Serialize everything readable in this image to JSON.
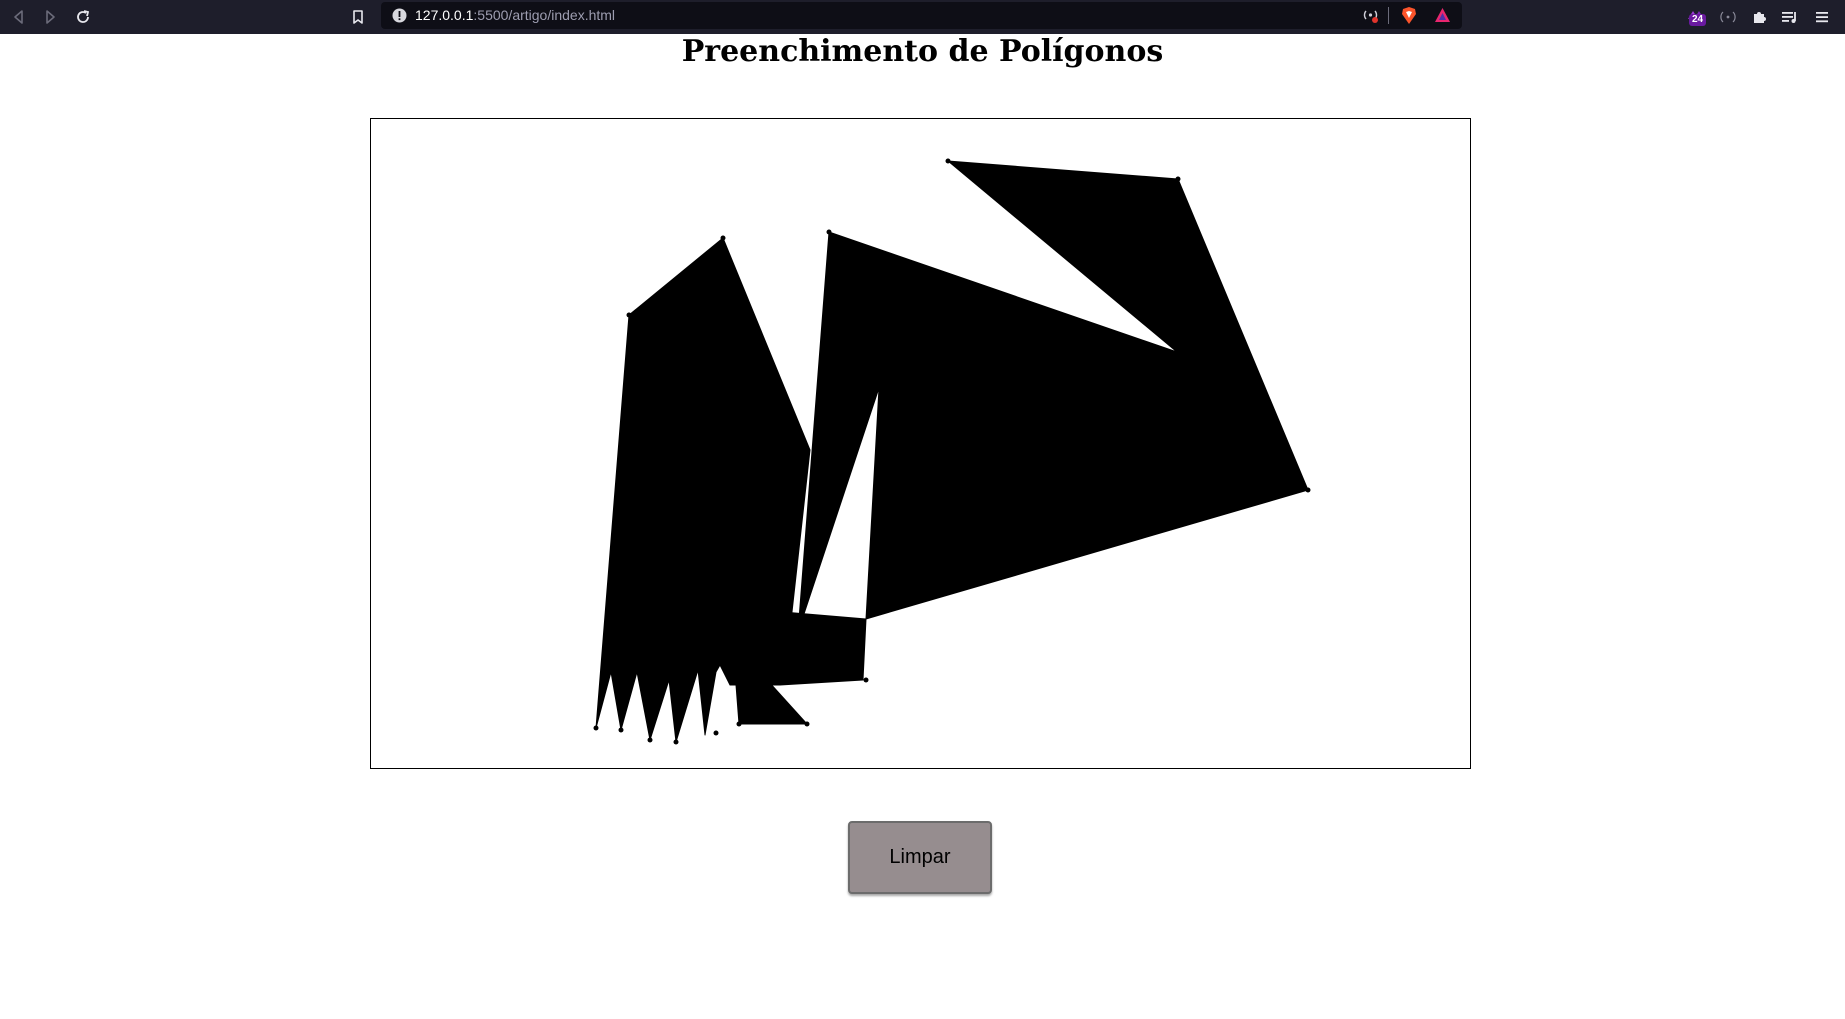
{
  "browser": {
    "url_host": "127.0.0.1",
    "url_path": ":5500/artigo/index.html",
    "extension_badge": "24",
    "icons": [
      "back-icon",
      "forward-icon",
      "reload-icon",
      "bookmark-icon",
      "info-icon",
      "broadcast-icon",
      "brave-shield-icon",
      "brave-rewards-icon",
      "extension-icon",
      "wallet-icon",
      "extensions-puzzle-icon",
      "playlist-icon",
      "menu-icon"
    ]
  },
  "page": {
    "title": "Preenchimento de Polígonos",
    "clear_button_label": "Limpar"
  },
  "colors": {
    "toolbar": "#1e1e2b",
    "urlbar": "#0e0e16",
    "polygon_fill": "#000000",
    "button": "#968d8f"
  }
}
